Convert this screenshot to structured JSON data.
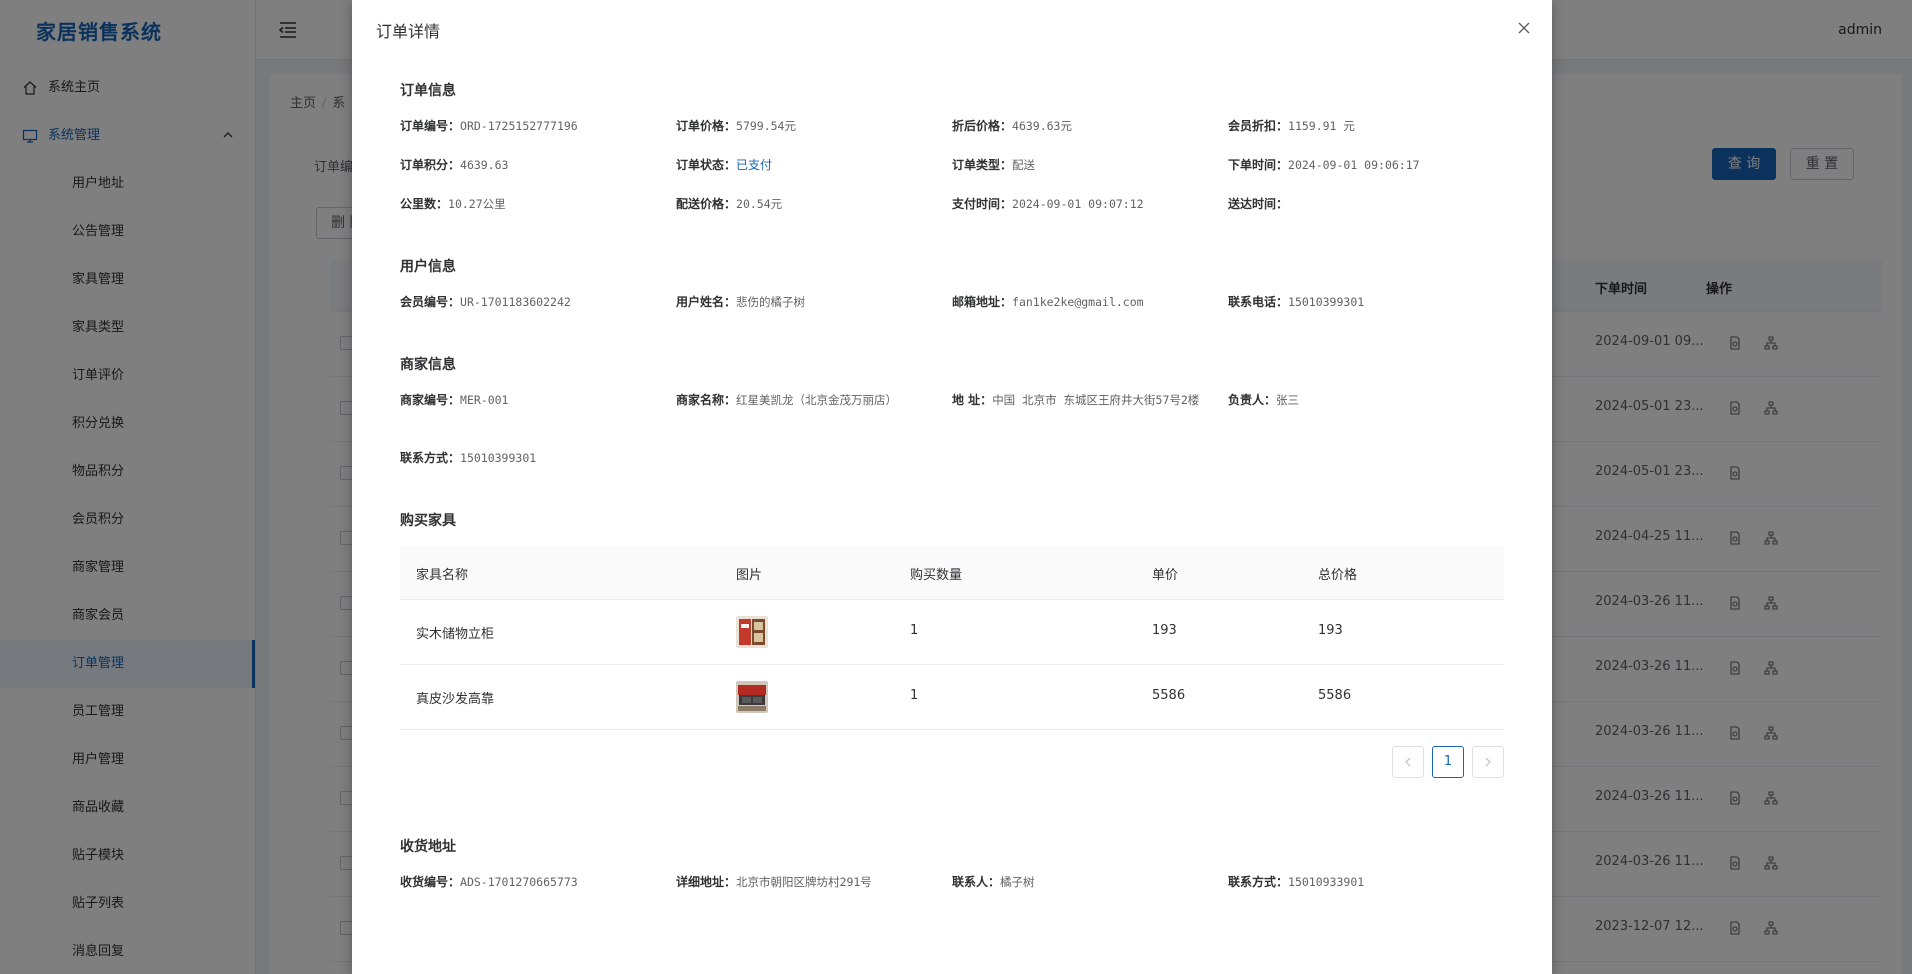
{
  "app": {
    "title": "家居销售系统",
    "user": "admin"
  },
  "sidebar": {
    "home": "系统主页",
    "group": "系统管理",
    "items": [
      "用户地址",
      "公告管理",
      "家具管理",
      "家具类型",
      "订单评价",
      "积分兑换",
      "物品积分",
      "会员积分",
      "商家管理",
      "商家会员",
      "订单管理",
      "员工管理",
      "用户管理",
      "商品收藏",
      "贴子模块",
      "贴子列表",
      "消息回复"
    ],
    "active": "订单管理"
  },
  "background": {
    "breadcrumb": [
      "主页",
      "系"
    ],
    "filter_label": "订单编",
    "query_button": "查 询",
    "reset_button": "重 置",
    "delete_button": "删 除",
    "columns": {
      "time": "下单时间",
      "ops": "操作"
    },
    "rows": [
      {
        "time": "2024-09-01 09...",
        "ops": 2
      },
      {
        "time": "2024-05-01 23...",
        "ops": 2
      },
      {
        "time": "2024-05-01 23...",
        "ops": 1
      },
      {
        "time": "2024-04-25 11...",
        "ops": 2
      },
      {
        "time": "2024-03-26 11...",
        "ops": 2
      },
      {
        "time": "2024-03-26 11...",
        "ops": 2
      },
      {
        "time": "2024-03-26 11...",
        "ops": 2
      },
      {
        "time": "2024-03-26 11...",
        "ops": 2
      },
      {
        "time": "2024-03-26 11...",
        "ops": 2
      },
      {
        "time": "2023-12-07 12...",
        "ops": 2
      }
    ]
  },
  "dialog": {
    "title": "订单详情",
    "order": {
      "title": "订单信息",
      "order_no_label": "订单编号：",
      "order_no": "ORD-1725152777196",
      "price_label": "订单价格：",
      "price": "5799.54元",
      "discounted_label": "折后价格：",
      "discounted": "4639.63元",
      "member_discount_label": "会员折扣：",
      "member_discount": "1159.91 元",
      "points_label": "订单积分：",
      "points": "4639.63",
      "status_label": "订单状态：",
      "status": "已支付",
      "type_label": "订单类型：",
      "type": "配送",
      "order_time_label": "下单时间：",
      "order_time": "2024-09-01 09:06:17",
      "distance_label": "公里数：",
      "distance": "10.27公里",
      "delivery_price_label": "配送价格：",
      "delivery_price": "20.54元",
      "pay_time_label": "支付时间：",
      "pay_time": "2024-09-01 09:07:12",
      "delivered_label": "送达时间：",
      "delivered": ""
    },
    "user": {
      "title": "用户信息",
      "member_no_label": "会员编号：",
      "member_no": "UR-1701183602242",
      "name_label": "用户姓名：",
      "name": "悲伤的橘子树",
      "email_label": "邮箱地址：",
      "email": "fan1ke2ke@gmail.com",
      "phone_label": "联系电话：",
      "phone": "15010399301"
    },
    "merchant": {
      "title": "商家信息",
      "no_label": "商家编号：",
      "no": "MER-001",
      "name_label": "商家名称：",
      "name": "红星美凯龙（北京金茂万丽店）",
      "address_label": "地 址：",
      "address": "中国 北京市 东城区王府井大街57号2楼",
      "manager_label": "负责人：",
      "manager": "张三",
      "contact_label": "联系方式：",
      "contact": "15010399301"
    },
    "furniture": {
      "title": "购买家具",
      "headers": [
        "家具名称",
        "图片",
        "购买数量",
        "单价",
        "总价格"
      ],
      "rows": [
        {
          "name": "实木储物立柜",
          "qty": "1",
          "unit": "193",
          "total": "193"
        },
        {
          "name": "真皮沙发高靠",
          "qty": "1",
          "unit": "5586",
          "total": "5586"
        }
      ],
      "page": "1"
    },
    "address": {
      "title": "收货地址",
      "no_label": "收货编号：",
      "no": "ADS-1701270665773",
      "detail_label": "详细地址：",
      "detail": "北京市朝阳区牌坊村291号",
      "contact_label": "联系人：",
      "contact": "橘子树",
      "phone_label": "联系方式：",
      "phone": "15010933901"
    }
  }
}
